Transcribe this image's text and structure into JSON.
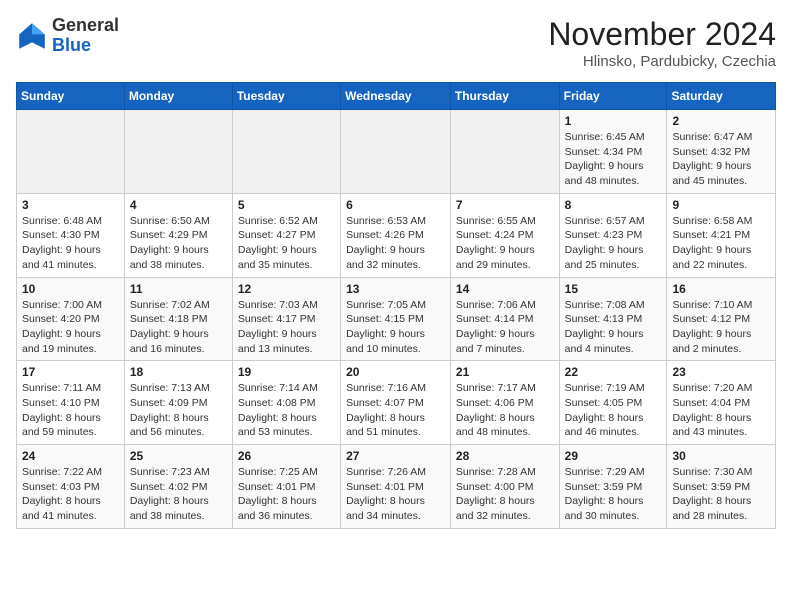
{
  "logo": {
    "general": "General",
    "blue": "Blue"
  },
  "header": {
    "month": "November 2024",
    "location": "Hlinsko, Pardubicky, Czechia"
  },
  "days_of_week": [
    "Sunday",
    "Monday",
    "Tuesday",
    "Wednesday",
    "Thursday",
    "Friday",
    "Saturday"
  ],
  "weeks": [
    [
      {
        "day": "",
        "info": ""
      },
      {
        "day": "",
        "info": ""
      },
      {
        "day": "",
        "info": ""
      },
      {
        "day": "",
        "info": ""
      },
      {
        "day": "",
        "info": ""
      },
      {
        "day": "1",
        "info": "Sunrise: 6:45 AM\nSunset: 4:34 PM\nDaylight: 9 hours and 48 minutes."
      },
      {
        "day": "2",
        "info": "Sunrise: 6:47 AM\nSunset: 4:32 PM\nDaylight: 9 hours and 45 minutes."
      }
    ],
    [
      {
        "day": "3",
        "info": "Sunrise: 6:48 AM\nSunset: 4:30 PM\nDaylight: 9 hours and 41 minutes."
      },
      {
        "day": "4",
        "info": "Sunrise: 6:50 AM\nSunset: 4:29 PM\nDaylight: 9 hours and 38 minutes."
      },
      {
        "day": "5",
        "info": "Sunrise: 6:52 AM\nSunset: 4:27 PM\nDaylight: 9 hours and 35 minutes."
      },
      {
        "day": "6",
        "info": "Sunrise: 6:53 AM\nSunset: 4:26 PM\nDaylight: 9 hours and 32 minutes."
      },
      {
        "day": "7",
        "info": "Sunrise: 6:55 AM\nSunset: 4:24 PM\nDaylight: 9 hours and 29 minutes."
      },
      {
        "day": "8",
        "info": "Sunrise: 6:57 AM\nSunset: 4:23 PM\nDaylight: 9 hours and 25 minutes."
      },
      {
        "day": "9",
        "info": "Sunrise: 6:58 AM\nSunset: 4:21 PM\nDaylight: 9 hours and 22 minutes."
      }
    ],
    [
      {
        "day": "10",
        "info": "Sunrise: 7:00 AM\nSunset: 4:20 PM\nDaylight: 9 hours and 19 minutes."
      },
      {
        "day": "11",
        "info": "Sunrise: 7:02 AM\nSunset: 4:18 PM\nDaylight: 9 hours and 16 minutes."
      },
      {
        "day": "12",
        "info": "Sunrise: 7:03 AM\nSunset: 4:17 PM\nDaylight: 9 hours and 13 minutes."
      },
      {
        "day": "13",
        "info": "Sunrise: 7:05 AM\nSunset: 4:15 PM\nDaylight: 9 hours and 10 minutes."
      },
      {
        "day": "14",
        "info": "Sunrise: 7:06 AM\nSunset: 4:14 PM\nDaylight: 9 hours and 7 minutes."
      },
      {
        "day": "15",
        "info": "Sunrise: 7:08 AM\nSunset: 4:13 PM\nDaylight: 9 hours and 4 minutes."
      },
      {
        "day": "16",
        "info": "Sunrise: 7:10 AM\nSunset: 4:12 PM\nDaylight: 9 hours and 2 minutes."
      }
    ],
    [
      {
        "day": "17",
        "info": "Sunrise: 7:11 AM\nSunset: 4:10 PM\nDaylight: 8 hours and 59 minutes."
      },
      {
        "day": "18",
        "info": "Sunrise: 7:13 AM\nSunset: 4:09 PM\nDaylight: 8 hours and 56 minutes."
      },
      {
        "day": "19",
        "info": "Sunrise: 7:14 AM\nSunset: 4:08 PM\nDaylight: 8 hours and 53 minutes."
      },
      {
        "day": "20",
        "info": "Sunrise: 7:16 AM\nSunset: 4:07 PM\nDaylight: 8 hours and 51 minutes."
      },
      {
        "day": "21",
        "info": "Sunrise: 7:17 AM\nSunset: 4:06 PM\nDaylight: 8 hours and 48 minutes."
      },
      {
        "day": "22",
        "info": "Sunrise: 7:19 AM\nSunset: 4:05 PM\nDaylight: 8 hours and 46 minutes."
      },
      {
        "day": "23",
        "info": "Sunrise: 7:20 AM\nSunset: 4:04 PM\nDaylight: 8 hours and 43 minutes."
      }
    ],
    [
      {
        "day": "24",
        "info": "Sunrise: 7:22 AM\nSunset: 4:03 PM\nDaylight: 8 hours and 41 minutes."
      },
      {
        "day": "25",
        "info": "Sunrise: 7:23 AM\nSunset: 4:02 PM\nDaylight: 8 hours and 38 minutes."
      },
      {
        "day": "26",
        "info": "Sunrise: 7:25 AM\nSunset: 4:01 PM\nDaylight: 8 hours and 36 minutes."
      },
      {
        "day": "27",
        "info": "Sunrise: 7:26 AM\nSunset: 4:01 PM\nDaylight: 8 hours and 34 minutes."
      },
      {
        "day": "28",
        "info": "Sunrise: 7:28 AM\nSunset: 4:00 PM\nDaylight: 8 hours and 32 minutes."
      },
      {
        "day": "29",
        "info": "Sunrise: 7:29 AM\nSunset: 3:59 PM\nDaylight: 8 hours and 30 minutes."
      },
      {
        "day": "30",
        "info": "Sunrise: 7:30 AM\nSunset: 3:59 PM\nDaylight: 8 hours and 28 minutes."
      }
    ]
  ]
}
